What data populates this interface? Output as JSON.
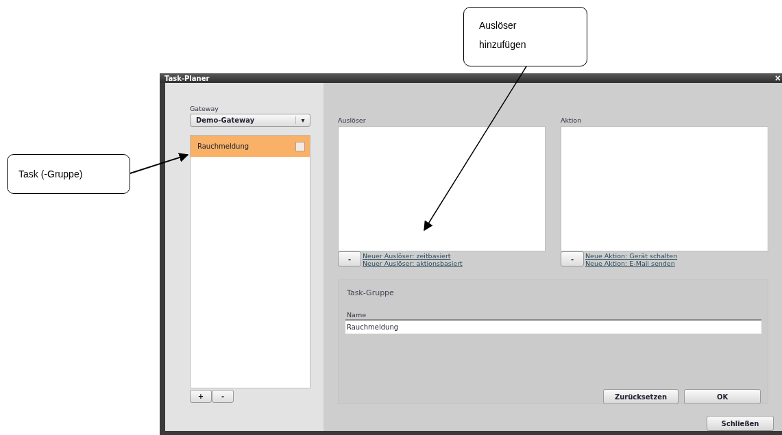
{
  "window": {
    "title": "Task-Planer",
    "close": "×"
  },
  "gateway": {
    "label": "Gateway",
    "value": "Demo-Gateway",
    "caret": "▾"
  },
  "tasks": [
    {
      "label": "Rauchmeldung",
      "selected": true,
      "checked": false
    }
  ],
  "task_buttons": [
    "+",
    "-"
  ],
  "trigger": {
    "label": "Auslöser",
    "remove": "-",
    "links": [
      "Neuer Auslöser: zeitbasiert",
      "Neuer Auslöser: aktionsbasiert"
    ]
  },
  "action": {
    "label": "Aktion",
    "remove": "-",
    "links": [
      "Neue Aktion: Gerät schalten",
      "Neue Aktion: E-Mail senden"
    ]
  },
  "group": {
    "title": "Task-Gruppe",
    "name_label": "Name",
    "name_value": "Rauchmeldung",
    "buttons": [
      "Zurücksetzen",
      "OK"
    ]
  },
  "close_button": "Schließen",
  "callouts": [
    {
      "text": "Task (-Gruppe)"
    },
    {
      "text": "Auslöser hinzufügen"
    }
  ]
}
